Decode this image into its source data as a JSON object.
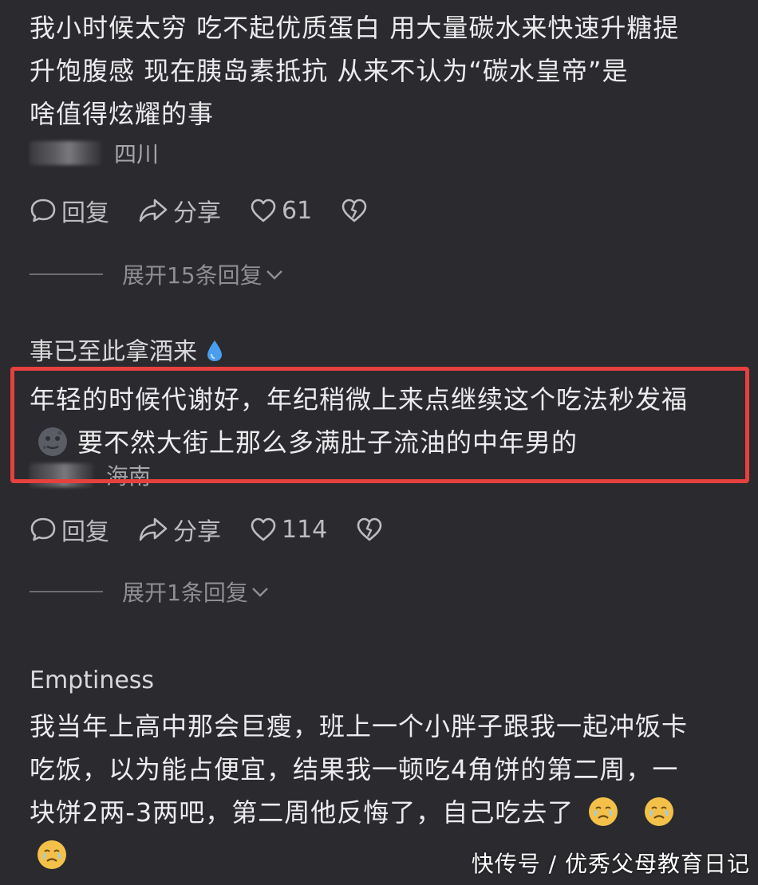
{
  "comments": [
    {
      "username": "",
      "lines": [
        "我小时候太穷  吃不起优质蛋白  用大量碳水来快速升糖提",
        "升饱腹感    现在胰岛素抵抗   从来不认为“碳水皇帝”是",
        "啥值得炫耀的事"
      ],
      "location": "四川",
      "reply_label": "回复",
      "share_label": "分享",
      "likes": "61",
      "expand_label": "展开15条回复"
    },
    {
      "username": "事已至此拿酒来",
      "lines": [
        "年轻的时候代谢好，年纪稍微上来点继续这个吃法秒发福",
        "要不然大街上那么多满肚子流油的中年男的"
      ],
      "location": "海南",
      "reply_label": "回复",
      "share_label": "分享",
      "likes": "114",
      "expand_label": "展开1条回复"
    },
    {
      "username": "Emptiness",
      "lines": [
        "我当年上高中那会巨瘦，班上一个小胖子跟我一起冲饭卡",
        "吃饭，以为能占便宜，结果我一顿吃4角饼的第二周，一",
        "块饼2两-3两吧，第二周他反悔了，自己吃去了"
      ]
    }
  ],
  "watermark": "快传号 / 优秀父母教育日记",
  "colors": {
    "background": "#2b2a2e",
    "highlight_border": "#e6403f",
    "water_drop": "#4a9ef0"
  }
}
